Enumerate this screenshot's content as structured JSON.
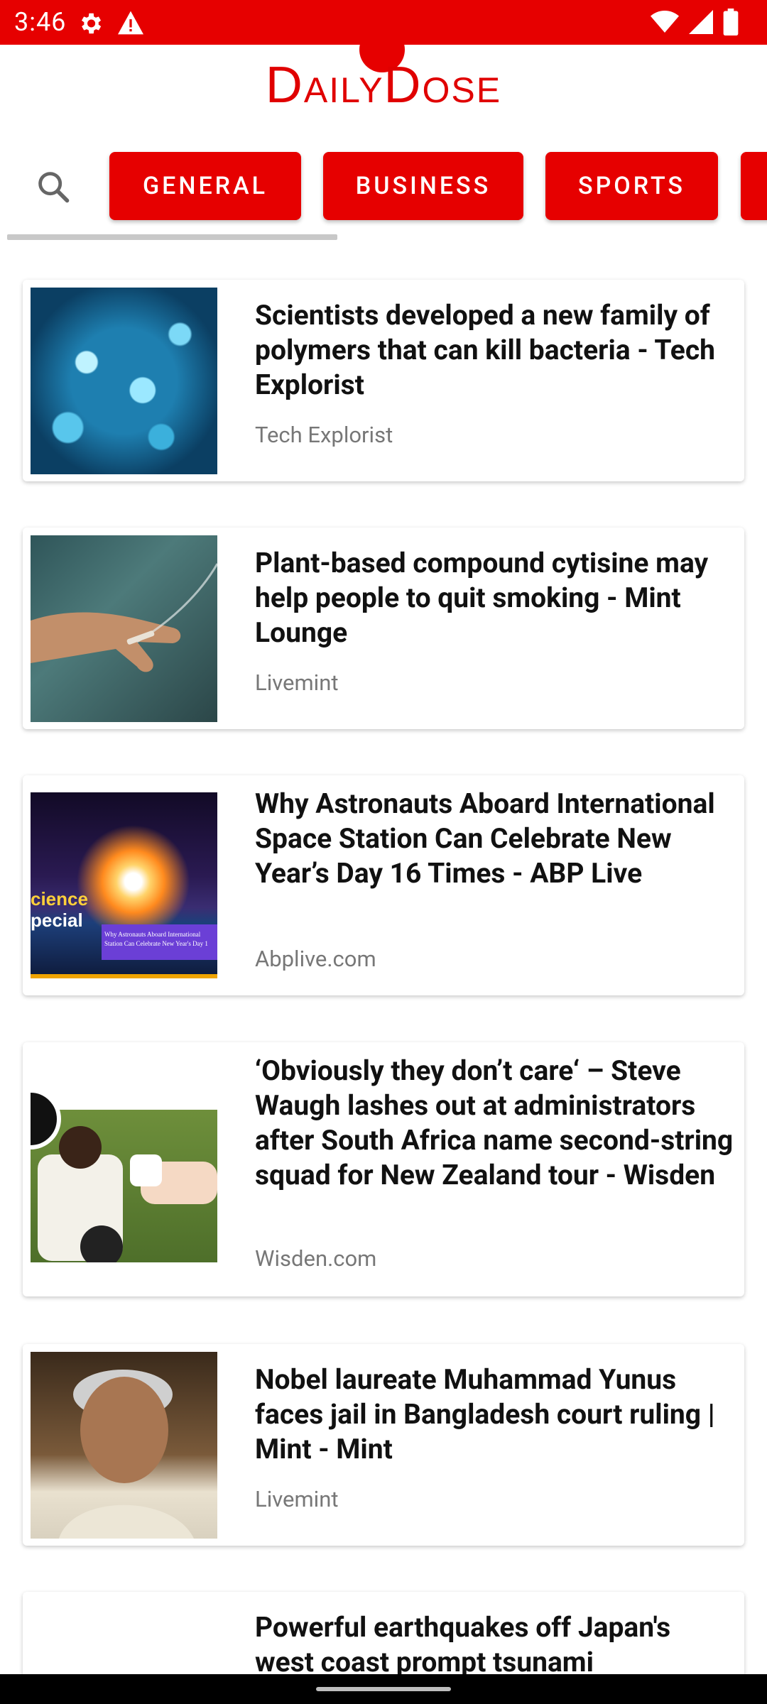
{
  "status_bar": {
    "time": "3:46",
    "icons": [
      "gear-icon",
      "warning-icon",
      "wifi-icon",
      "cell-signal-icon",
      "battery-icon"
    ],
    "color": "#e60000"
  },
  "app": {
    "title": "DailyDose",
    "accent": "#e00000"
  },
  "categories": [
    {
      "label": "GENERAL"
    },
    {
      "label": "BUSINESS"
    },
    {
      "label": "SPORTS"
    }
  ],
  "articles": [
    {
      "headline": "Scientists developed a new family of polymers that can kill bacteria - Tech Explorist",
      "source": "Tech Explorist"
    },
    {
      "headline": "Plant-based compound cytisine may help people to quit smoking - Mint Lounge",
      "source": "Livemint"
    },
    {
      "headline": "Why Astronauts Aboard International Space Station Can Celebrate New Year’s Day 16 Times - ABP Live",
      "source": "Abplive.com",
      "image_text": [
        "cience",
        "pecial",
        "Why Astronauts Aboard International",
        "Station Can Celebrate New Year's Day 1"
      ]
    },
    {
      "headline": "‘Obviously they don’t care‘ – Steve Waugh lashes out at administrators after South Africa name second-string squad for New Zealand tour - Wisden",
      "source": "Wisden.com"
    },
    {
      "headline": "Nobel laureate Muhammad Yunus faces jail in Bangladesh court ruling | Mint - Mint",
      "source": "Livemint"
    },
    {
      "headline": "Powerful earthquakes off Japan's west coast prompt tsunami",
      "source": ""
    }
  ]
}
